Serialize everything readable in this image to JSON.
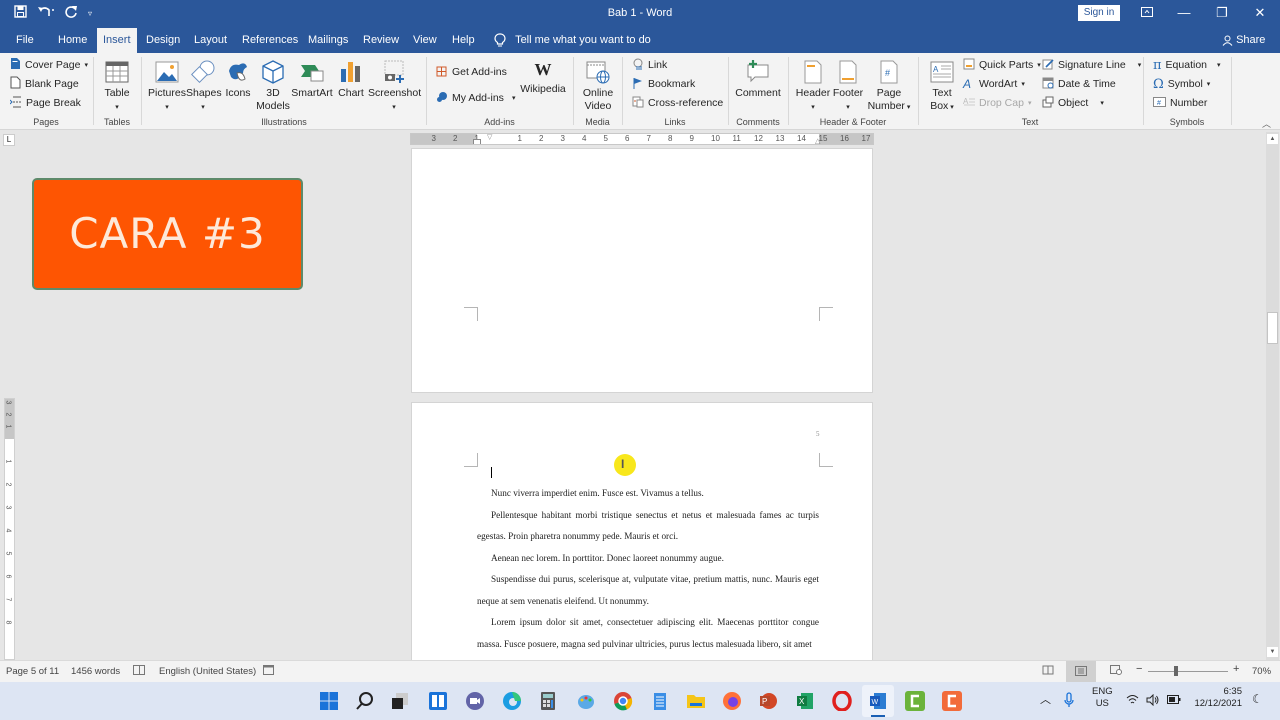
{
  "titlebar": {
    "title": "Bab 1 - Word",
    "sign_in": "Sign in",
    "qat": {
      "save_icon": "save-icon",
      "undo_icon": "undo-icon",
      "redo_icon": "redo-icon",
      "customize_icon": "customize-qat-icon"
    },
    "window_buttons": {
      "ribbon_display": "ribbon-display-icon",
      "minimize": "—",
      "restore": "❐",
      "close": "✕"
    }
  },
  "tabs": [
    {
      "label": "File"
    },
    {
      "label": "Home"
    },
    {
      "label": "Insert",
      "active": true
    },
    {
      "label": "Design"
    },
    {
      "label": "Layout"
    },
    {
      "label": "References"
    },
    {
      "label": "Mailings"
    },
    {
      "label": "Review"
    },
    {
      "label": "View"
    },
    {
      "label": "Help"
    }
  ],
  "tell_me": "Tell me what you want to do",
  "share": "Share",
  "ribbon": {
    "pages": {
      "label": "Pages",
      "cover_page": "Cover Page",
      "blank_page": "Blank Page",
      "page_break": "Page Break"
    },
    "tables": {
      "label": "Tables",
      "table": "Table"
    },
    "illustrations": {
      "label": "Illustrations",
      "pictures": "Pictures",
      "shapes": "Shapes",
      "icons": "Icons",
      "models_1": "3D",
      "models_2": "Models",
      "smartart": "SmartArt",
      "chart": "Chart",
      "screenshot": "Screenshot"
    },
    "addins": {
      "label": "Add-ins",
      "get_addins": "Get Add-ins",
      "my_addins": "My Add-ins",
      "wikipedia": "Wikipedia"
    },
    "media": {
      "label": "Media",
      "online_1": "Online",
      "online_2": "Video"
    },
    "links": {
      "label": "Links",
      "link": "Link",
      "bookmark": "Bookmark",
      "cross_reference": "Cross-reference"
    },
    "comments": {
      "label": "Comments",
      "comment": "Comment"
    },
    "header_footer": {
      "label": "Header & Footer",
      "header": "Header",
      "footer": "Footer",
      "page_1": "Page",
      "page_2": "Number"
    },
    "text": {
      "label": "Text",
      "text_box_1": "Text",
      "text_box_2": "Box",
      "quick_parts": "Quick Parts",
      "wordart": "WordArt",
      "drop_cap": "Drop Cap",
      "signature_line": "Signature Line",
      "date_time": "Date & Time",
      "object": "Object"
    },
    "symbols": {
      "label": "Symbols",
      "equation": "Equation",
      "symbol": "Symbol",
      "number": "Number"
    }
  },
  "ruler": {
    "ticks": [
      "3",
      "2",
      "1",
      "1",
      "2",
      "3",
      "4",
      "5",
      "6",
      "7",
      "8",
      "9",
      "10",
      "11",
      "12",
      "13",
      "14",
      "15",
      "16",
      "17"
    ],
    "vticks": [
      "3",
      "2",
      "1",
      "1",
      "2",
      "3",
      "4",
      "5",
      "6",
      "7",
      "8"
    ]
  },
  "overlay": {
    "label": "CARA #3",
    "color": "#fe5502"
  },
  "document": {
    "page_number": "5",
    "paragraphs": [
      "Nunc viverra imperdiet enim. Fusce est. Vivamus a tellus.",
      "Pellentesque habitant morbi tristique senectus et netus et malesuada fames ac turpis egestas. Proin pharetra nonummy pede. Mauris et orci.",
      "Aenean nec lorem. In porttitor. Donec laoreet nonummy augue.",
      "Suspendisse dui purus, scelerisque at, vulputate vitae, pretium mattis, nunc. Mauris eget neque at sem venenatis eleifend. Ut nonummy.",
      "Lorem ipsum dolor sit amet, consectetuer adipiscing elit. Maecenas porttitor congue massa. Fusce posuere, magna sed pulvinar ultricies, purus lectus malesuada libero, sit amet"
    ]
  },
  "statusbar": {
    "page": "Page 5 of 11",
    "words": "1456 words",
    "language": "English (United States)",
    "zoom": "70%",
    "zoom_minus": "−",
    "zoom_plus": "+"
  },
  "taskbar": {
    "apps": [
      "start",
      "search",
      "task-view",
      "widgets",
      "teams-chat",
      "edge",
      "calculator",
      "paint",
      "chrome",
      "notepad",
      "file-explorer",
      "firefox",
      "powerpoint",
      "excel",
      "opera",
      "word",
      "camtasia-green",
      "camtasia-orange"
    ],
    "lang_1": "ENG",
    "lang_2": "US",
    "time": "6:35",
    "date": "12/12/2021"
  }
}
